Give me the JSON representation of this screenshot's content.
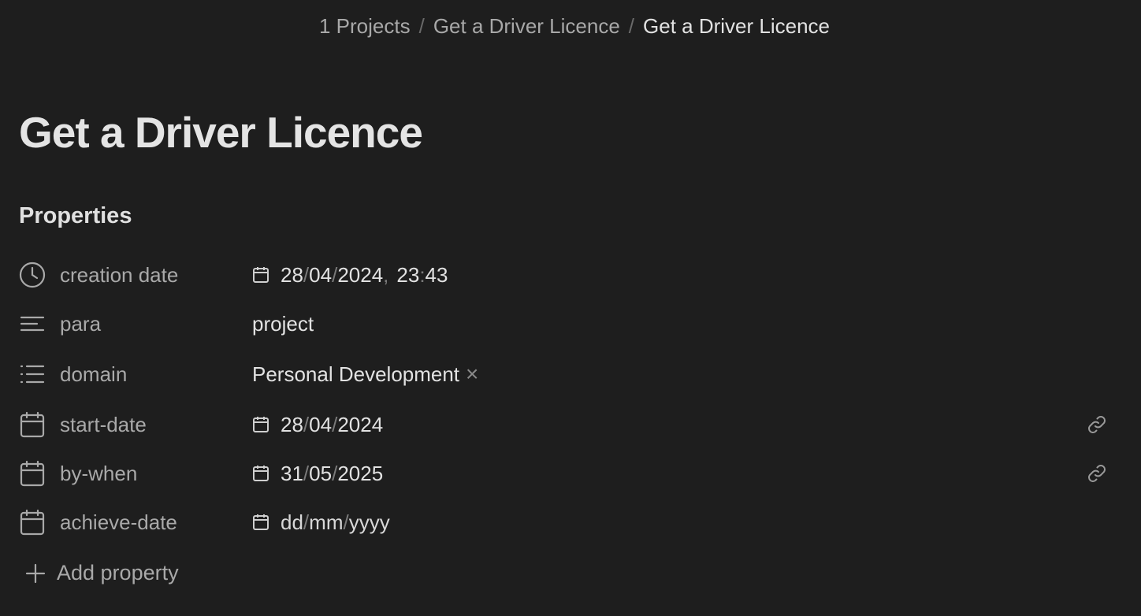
{
  "breadcrumb": {
    "items": [
      "1 Projects",
      "Get a Driver Licence",
      "Get a Driver Licence"
    ],
    "separator": "/"
  },
  "page": {
    "title": "Get a Driver Licence"
  },
  "properties": {
    "heading": "Properties",
    "rows": [
      {
        "icon": "clock-icon",
        "key": "creation date",
        "value": {
          "day": "28",
          "month": "04",
          "year": "2024",
          "comma": ",",
          "hour": "23",
          "colon": ":",
          "minute": "43"
        }
      },
      {
        "icon": "text-lines-icon",
        "key": "para",
        "value": "project"
      },
      {
        "icon": "list-icon",
        "key": "domain",
        "value": "Personal Development",
        "remove": "×"
      },
      {
        "icon": "calendar-icon",
        "key": "start-date",
        "value": {
          "day": "28",
          "month": "04",
          "year": "2024"
        },
        "link_icon": "link-icon"
      },
      {
        "icon": "calendar-icon",
        "key": "by-when",
        "value": {
          "day": "31",
          "month": "05",
          "year": "2025"
        },
        "link_icon": "link-icon"
      },
      {
        "icon": "calendar-icon",
        "key": "achieve-date",
        "value": {
          "day": "dd",
          "month": "mm",
          "year": "yyyy"
        }
      }
    ],
    "date_separator": "/",
    "add_label": "Add property"
  },
  "colors": {
    "background": "#1e1e1e",
    "text_primary": "#e2e2e2",
    "text_muted": "#a9a9a9"
  }
}
